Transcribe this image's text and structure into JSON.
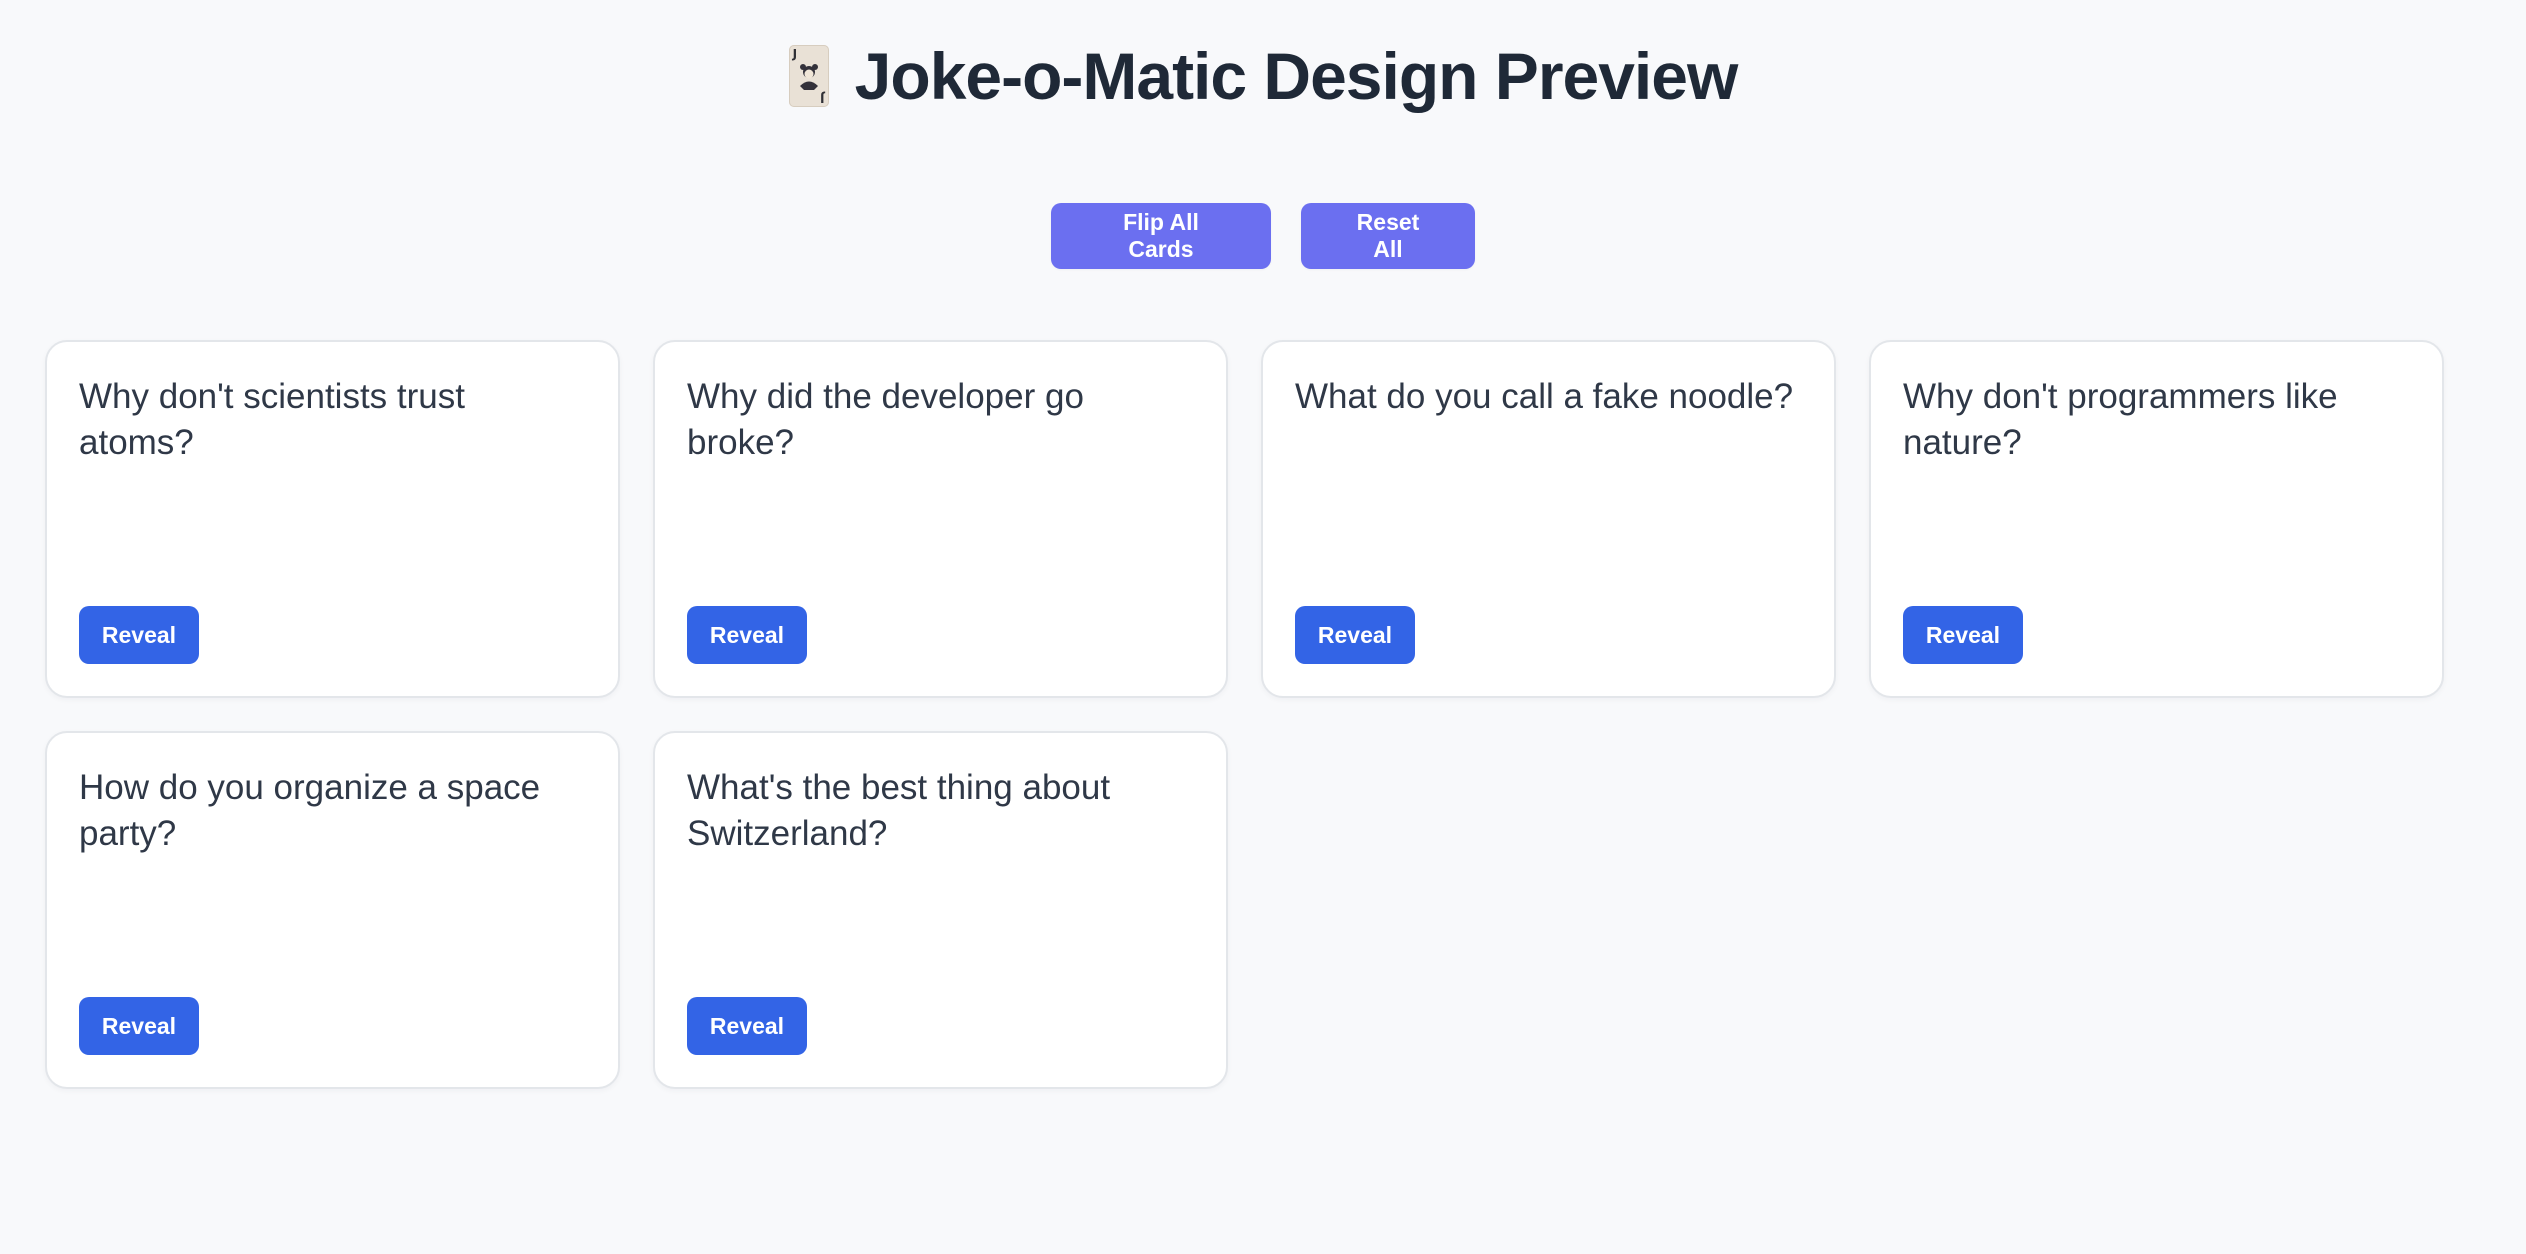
{
  "header": {
    "title": "Joke-o-Matic Design Preview",
    "icon": "joker-card-icon",
    "icon_letter": "J"
  },
  "controls": {
    "flip_all_label": "Flip All Cards",
    "reset_all_label": "Reset All"
  },
  "cards": [
    {
      "question": "Why don't scientists trust atoms?",
      "button_label": "Reveal"
    },
    {
      "question": "Why did the developer go broke?",
      "button_label": "Reveal"
    },
    {
      "question": "What do you call a fake noodle?",
      "button_label": "Reveal"
    },
    {
      "question": "Why don't programmers like nature?",
      "button_label": "Reveal"
    },
    {
      "question": "How do you organize a space party?",
      "button_label": "Reveal"
    },
    {
      "question": "What's the best thing about Switzerland?",
      "button_label": "Reveal"
    }
  ],
  "colors": {
    "background": "#f8f9fb",
    "control_button": "#6b6ff0",
    "reveal_button": "#3364e6",
    "title_text": "#1f2937"
  }
}
